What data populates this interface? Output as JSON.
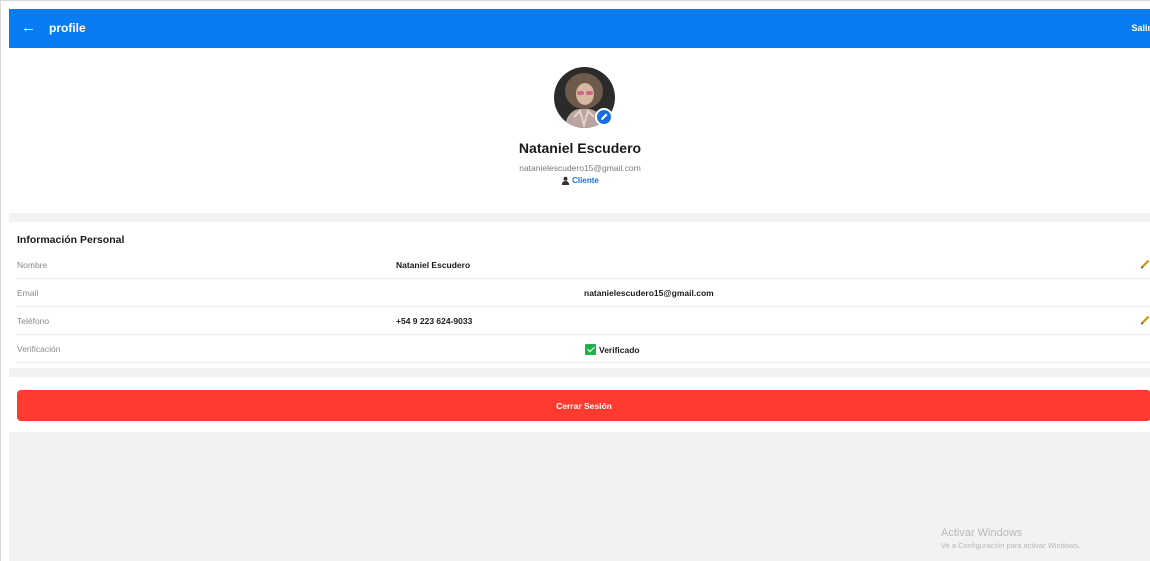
{
  "topbar": {
    "back_icon": "arrow-left-icon",
    "title": "profile",
    "logout_link": "Salir"
  },
  "profile": {
    "name": "Nataniel Escudero",
    "email": "natanielescudero15@gmail.com",
    "role": "Cliente",
    "edit_avatar_icon": "pencil-icon"
  },
  "info": {
    "section_title": "Información Personal",
    "rows": [
      {
        "label": "Nombre",
        "value": "Nataniel Escudero",
        "editable": true
      },
      {
        "label": "Email",
        "value": "natanielescudero15@gmail.com",
        "editable": false
      },
      {
        "label": "Teléfono",
        "value": "+54 9 223 624-9033",
        "editable": true
      },
      {
        "label": "Verificación",
        "value": "Verificado",
        "editable": false
      }
    ]
  },
  "actions": {
    "logout_button": "Cerrar Sesión"
  },
  "watermark": {
    "title": "Activar Windows",
    "subtitle": "Ve a Configuración para activar Windows."
  },
  "colors": {
    "accent": "#0a7cf2",
    "danger": "#ff3b30",
    "verified": "#22b04b"
  }
}
